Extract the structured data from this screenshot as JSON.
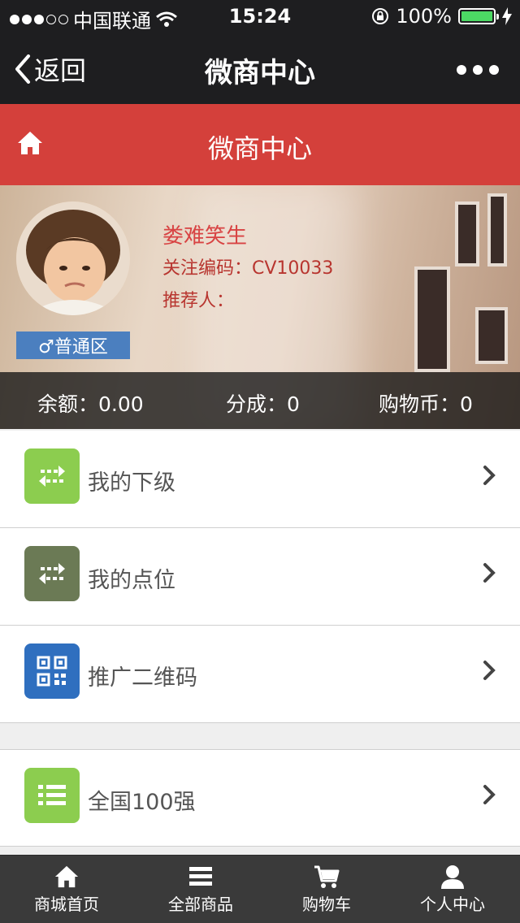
{
  "status_bar": {
    "carrier": "中国联通",
    "time": "15:24",
    "battery": "100%"
  },
  "navbar": {
    "back_label": "返回",
    "title": "微商中心"
  },
  "header": {
    "title": "微商中心"
  },
  "profile": {
    "name": "娄难笑生",
    "code_label": "关注编码：",
    "code_value": "CV10033",
    "referrer_label": "推荐人：",
    "tag": "♂普通区",
    "stats": [
      {
        "label": "余额：",
        "value": "0.00"
      },
      {
        "label": "分成：",
        "value": "0"
      },
      {
        "label": "购物币：",
        "value": "0"
      }
    ]
  },
  "menu": [
    {
      "label": "我的下级",
      "icon": "swap-arrows-icon",
      "color": "#8ccd4f"
    },
    {
      "label": "我的点位",
      "icon": "swap-arrows-icon",
      "color": "#6b7a55"
    },
    {
      "label": "推广二维码",
      "icon": "qr-code-icon",
      "color": "#2f6fbf"
    },
    {
      "label": "全国100强",
      "icon": "list-icon",
      "color": "#8ccd4f"
    }
  ],
  "tabbar": [
    {
      "label": "商城首页",
      "icon": "home-icon"
    },
    {
      "label": "全部商品",
      "icon": "menu-icon"
    },
    {
      "label": "购物车",
      "icon": "cart-icon"
    },
    {
      "label": "个人中心",
      "icon": "user-icon"
    }
  ],
  "colors": {
    "header_red": "#d4403b",
    "dark_bar": "#1e1e20",
    "tab_bg": "#3a3a3a",
    "name_red": "#d84343"
  }
}
